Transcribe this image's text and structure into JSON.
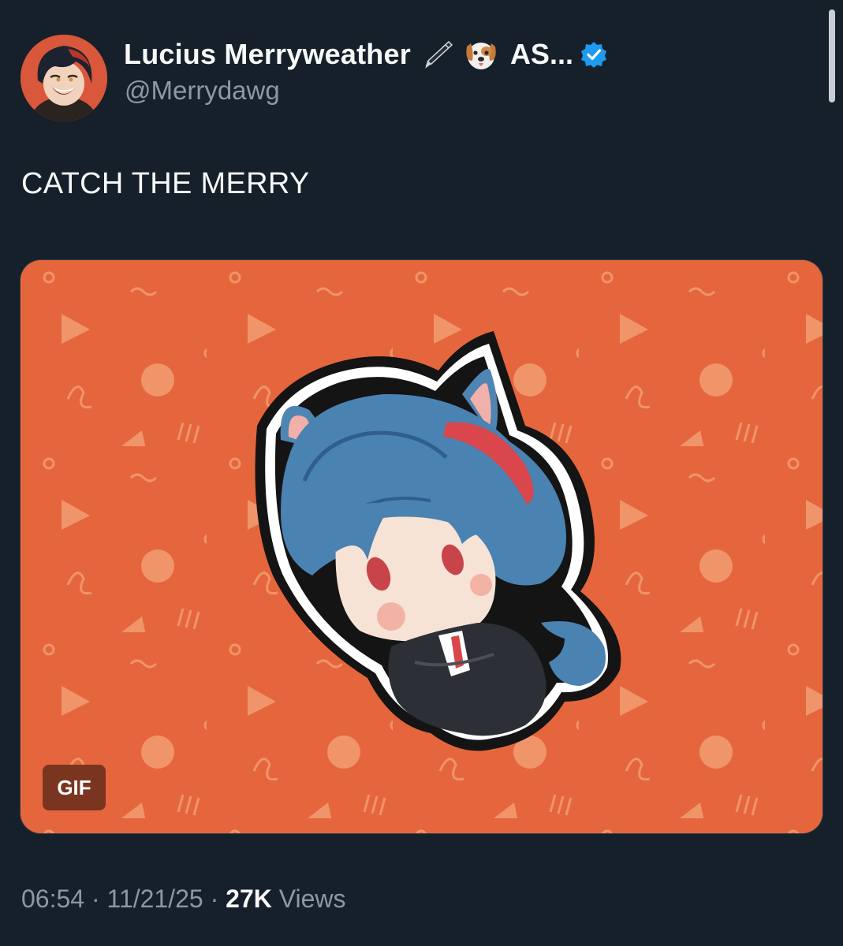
{
  "author": {
    "display_name": "Lucius Merryweather",
    "name_emoji": [
      "fountain-pen-emoji",
      "dog-face-emoji"
    ],
    "name_suffix": "AS...",
    "handle": "@Merrydawg",
    "verified": true
  },
  "tweet": {
    "text": "CATCH THE MERRY"
  },
  "media": {
    "badge": "GIF",
    "background_color": "#e5663c"
  },
  "meta": {
    "time": "06:54",
    "separator": "·",
    "date": "11/21/25",
    "views_count": "27K",
    "views_label": "Views"
  },
  "colors": {
    "background": "#15202b",
    "primary_text": "#f7f9f9",
    "secondary_text": "#8b98a5",
    "verified_blue": "#1d9bf0"
  }
}
